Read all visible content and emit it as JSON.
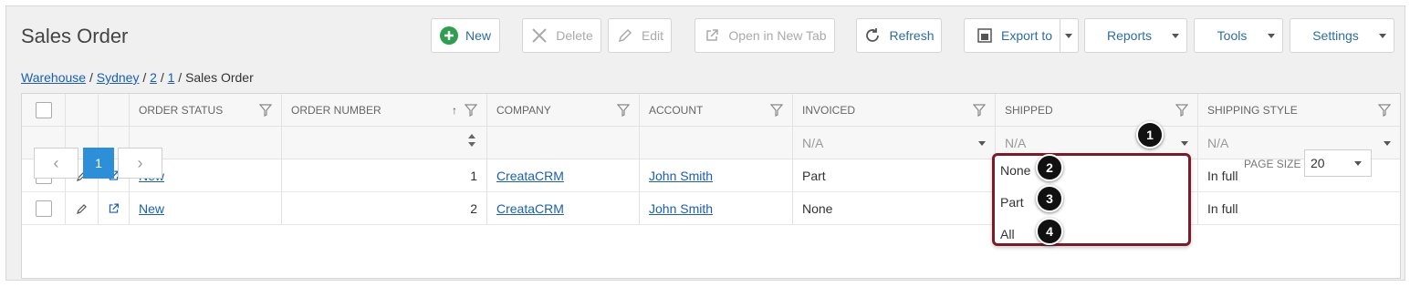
{
  "page": {
    "title": "Sales Order"
  },
  "toolbar": {
    "new_label": "New",
    "delete_label": "Delete",
    "edit_label": "Edit",
    "open_tab_label": "Open in New Tab",
    "refresh_label": "Refresh",
    "export_label": "Export to",
    "reports_label": "Reports",
    "tools_label": "Tools",
    "settings_label": "Settings"
  },
  "breadcrumb": {
    "items": [
      "Warehouse",
      "Sydney",
      "2",
      "1"
    ],
    "current": "Sales Order",
    "separator": "/"
  },
  "grid": {
    "columns": [
      "ORDER STATUS",
      "ORDER NUMBER",
      "COMPANY",
      "ACCOUNT",
      "INVOICED",
      "SHIPPED",
      "SHIPPING STYLE"
    ],
    "filters": {
      "invoiced": "N/A",
      "shipped": "N/A",
      "shipping_style": "N/A"
    },
    "rows": [
      {
        "order_status": "New",
        "order_number": "1",
        "company": "CreataCRM",
        "account": "John Smith",
        "invoiced": "Part",
        "shipped": "",
        "shipping_style": "In full"
      },
      {
        "order_status": "New",
        "order_number": "2",
        "company": "CreataCRM",
        "account": "John Smith",
        "invoiced": "None",
        "shipped": "",
        "shipping_style": "In full"
      }
    ]
  },
  "shipped_dropdown": {
    "options": [
      "None",
      "Part",
      "All"
    ]
  },
  "callouts": [
    "1",
    "2",
    "3",
    "4"
  ],
  "pager": {
    "current_page": "1",
    "prev": "‹",
    "next": "›"
  },
  "page_size": {
    "label": "PAGE SIZE",
    "value": "20"
  },
  "colors": {
    "accent": "#2d8fd8",
    "link": "#1a5fb4",
    "new_icon": "#2e9e4f",
    "highlight_border": "#7b1b2a"
  }
}
